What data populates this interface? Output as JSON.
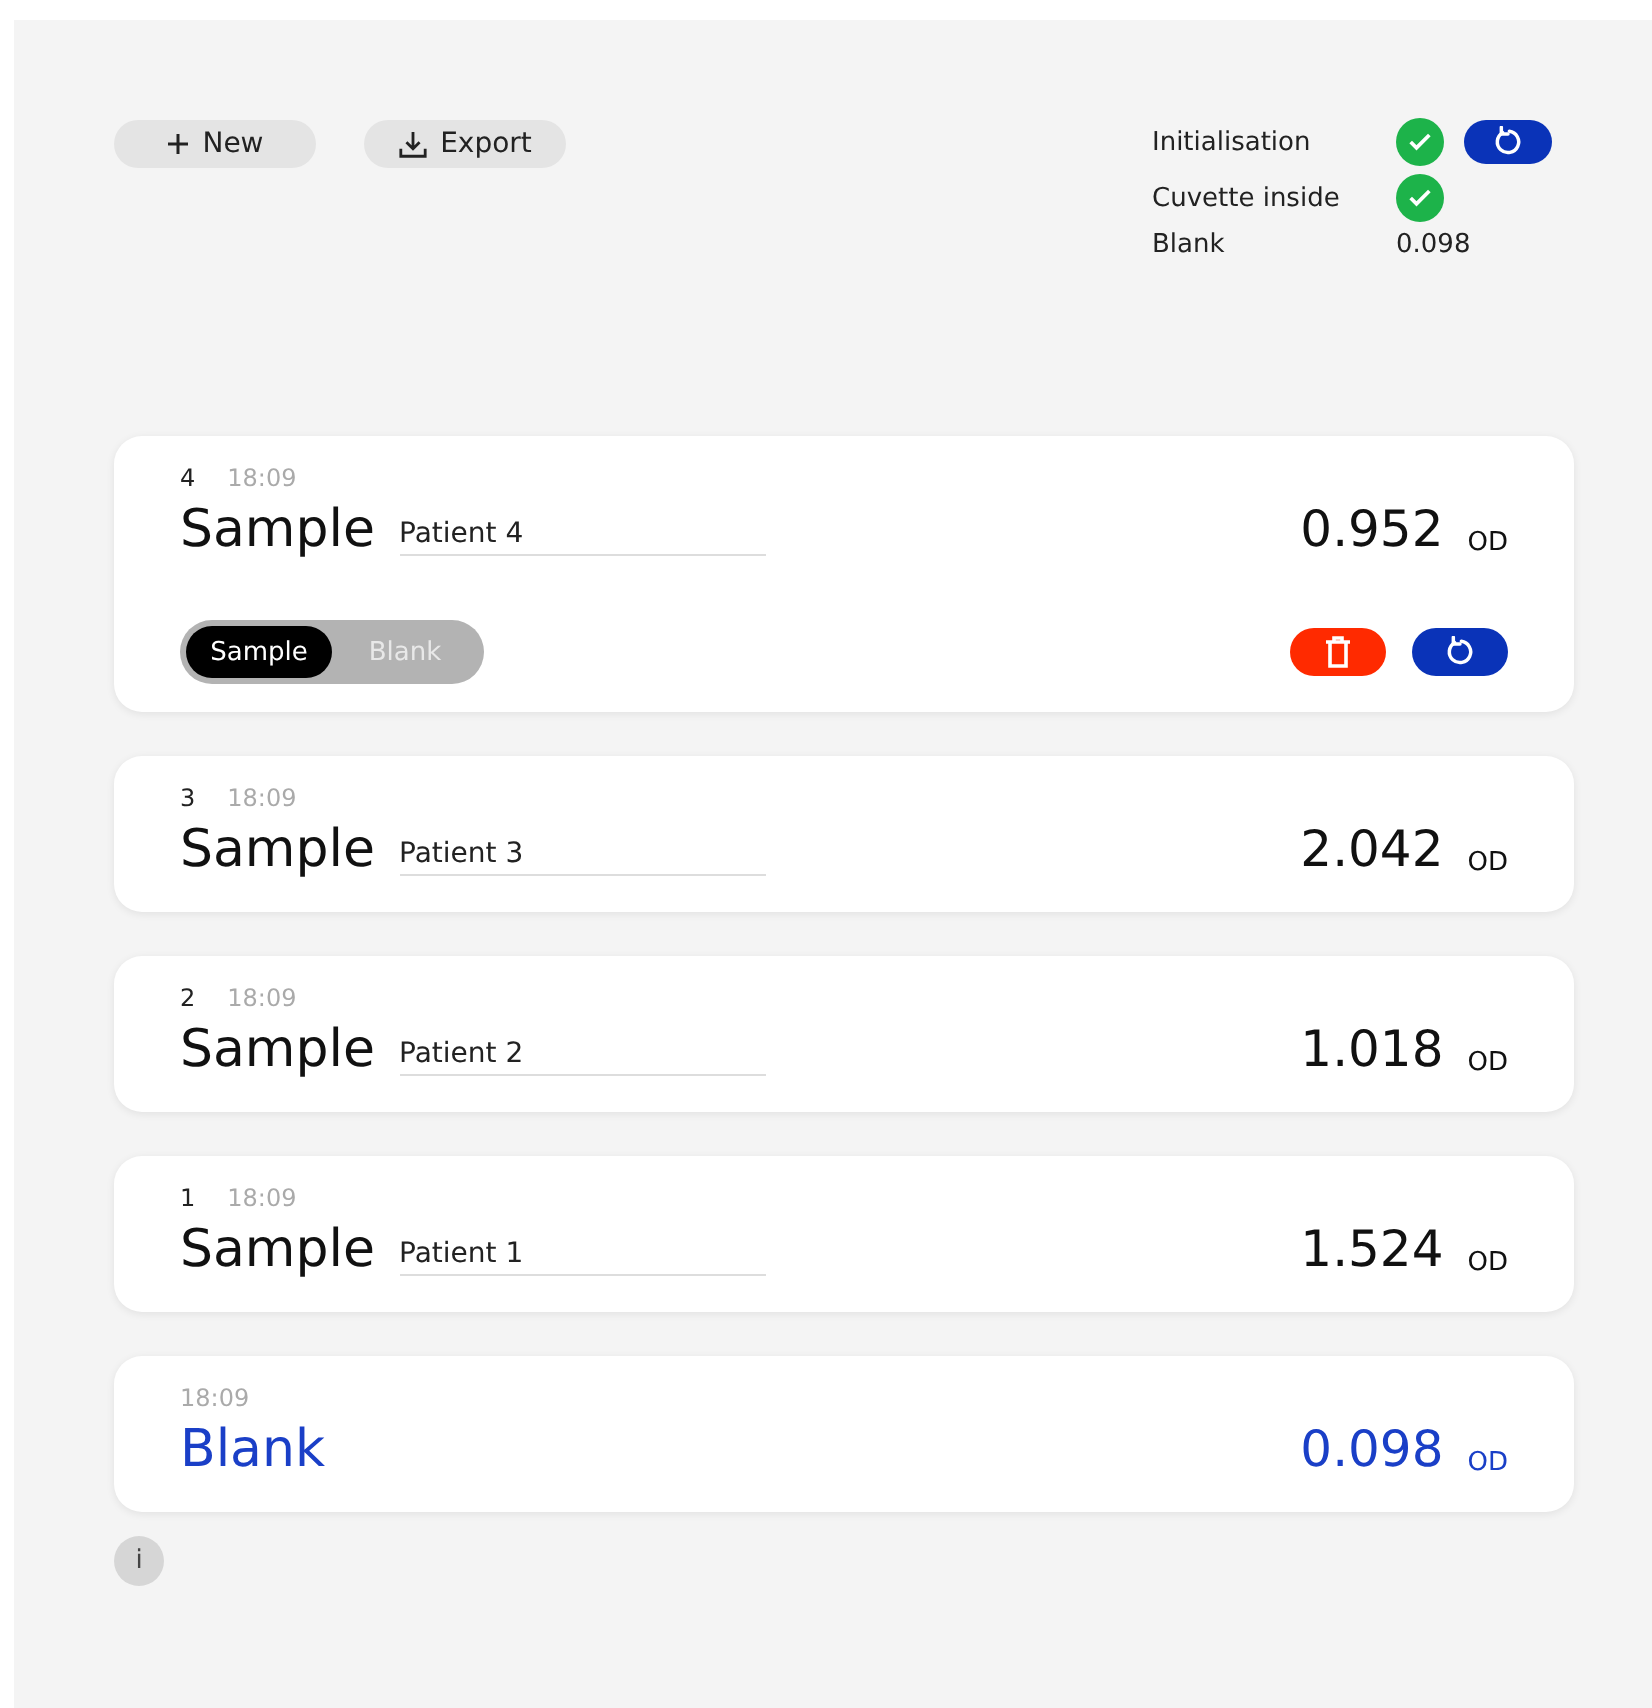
{
  "toolbar": {
    "buttons": [
      {
        "kind": "new",
        "label": "New"
      },
      {
        "kind": "export",
        "label": "Export"
      }
    ]
  },
  "status": [
    {
      "label": "Initialisation",
      "kind": "check",
      "ok": true,
      "reset": true
    },
    {
      "label": "Cuvette inside",
      "kind": "check",
      "ok": true,
      "reset": false
    },
    {
      "label": "Blank",
      "kind": "value",
      "value": "0.098"
    }
  ],
  "measurements": [
    {
      "kind": "sample",
      "index": "4",
      "time": "18:09",
      "title": "Sample",
      "patient": "Patient 4",
      "value": "0.952",
      "unit": "OD",
      "expanded": true,
      "type_options": [
        {
          "label": "Sample",
          "selected": true
        },
        {
          "label": "Blank",
          "selected": false
        }
      ]
    },
    {
      "kind": "sample",
      "index": "3",
      "time": "18:09",
      "title": "Sample",
      "patient": "Patient 3",
      "value": "2.042",
      "unit": "OD",
      "expanded": false
    },
    {
      "kind": "sample",
      "index": "2",
      "time": "18:09",
      "title": "Sample",
      "patient": "Patient 2",
      "value": "1.018",
      "unit": "OD",
      "expanded": false
    },
    {
      "kind": "sample",
      "index": "1",
      "time": "18:09",
      "title": "Sample",
      "patient": "Patient 1",
      "value": "1.524",
      "unit": "OD",
      "expanded": false
    },
    {
      "kind": "blank",
      "time": "18:09",
      "title": "Blank",
      "value": "0.098",
      "unit": "OD",
      "expanded": false
    }
  ],
  "info": {
    "label": "i"
  }
}
